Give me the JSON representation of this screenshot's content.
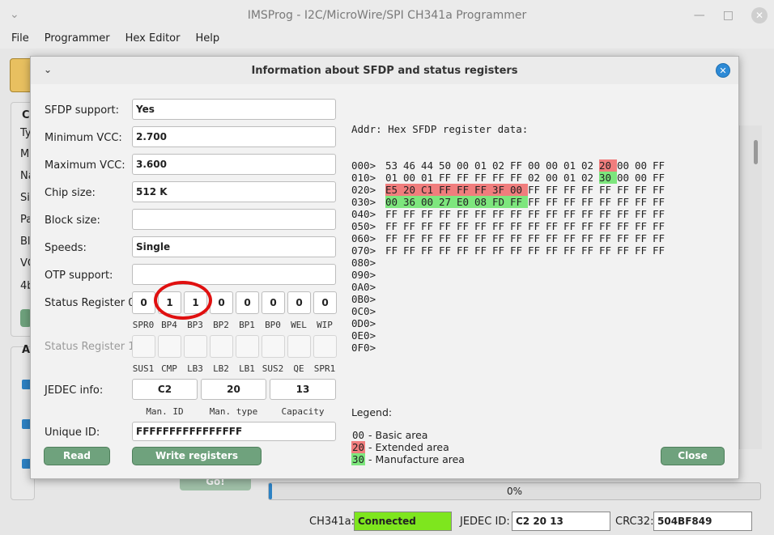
{
  "main": {
    "title": "IMSProg - I2C/MicroWire/SPI CH341a Programmer",
    "menu": [
      "File",
      "Programmer",
      "Hex Editor",
      "Help"
    ],
    "bg_labels": [
      "C",
      "Ty",
      "M",
      "Na",
      "Si",
      "Pa",
      "Bl",
      "VC",
      "4b",
      "A"
    ],
    "go_label": "Go!",
    "progress_text": "0%",
    "progress_value": 0.0,
    "status": {
      "ch341_label": "CH341a:",
      "ch341_value": "Connected",
      "jedec_label": "JEDEC ID:",
      "jedec_value": "C2 20 13",
      "crc_label": "CRC32:",
      "crc_value": "504BF849"
    }
  },
  "dialog": {
    "title": "Information about SFDP and status registers",
    "fields": [
      {
        "label": "SFDP support:",
        "value": "Yes"
      },
      {
        "label": "Minimum VCC:",
        "value": "2.700"
      },
      {
        "label": "Maximum VCC:",
        "value": "3.600"
      },
      {
        "label": "Chip size:",
        "value": "512 K"
      },
      {
        "label": "Block size:",
        "value": ""
      },
      {
        "label": "Speeds:",
        "value": "Single"
      },
      {
        "label": "OTP support:",
        "value": ""
      }
    ],
    "sr0": {
      "label": "Status Register 0",
      "bits": [
        "0",
        "1",
        "1",
        "0",
        "0",
        "0",
        "0",
        "0"
      ],
      "bit_names": [
        "SPR0",
        "BP4",
        "BP3",
        "BP2",
        "BP1",
        "BP0",
        "WEL",
        "WIP"
      ]
    },
    "sr1": {
      "label": "Status Register 1",
      "bits": [
        "",
        "",
        "",
        "",
        "",
        "",
        "",
        ""
      ],
      "bit_names": [
        "SUS1",
        "CMP",
        "LB3",
        "LB2",
        "LB1",
        "SUS2",
        "QE",
        "SPR1"
      ]
    },
    "jedec": {
      "label": "JEDEC info:",
      "values": [
        "C2",
        "20",
        "13"
      ],
      "names": [
        "Man. ID",
        "Man. type",
        "Capacity"
      ]
    },
    "unique": {
      "label": "Unique ID:",
      "value": "FFFFFFFFFFFFFFFF"
    },
    "buttons": {
      "read": "Read",
      "write": "Write registers",
      "close": "Close"
    },
    "hex_header": "Addr: Hex SFDP register data:",
    "hex_rows": [
      {
        "addr": "000>",
        "bytes": [
          "53",
          "46",
          "44",
          "50",
          "00",
          "01",
          "02",
          "FF",
          "00",
          "00",
          "01",
          "02",
          "20",
          "00",
          "00",
          "FF"
        ]
      },
      {
        "addr": "010>",
        "bytes": [
          "01",
          "00",
          "01",
          "FF",
          "FF",
          "FF",
          "FF",
          "FF",
          "02",
          "00",
          "01",
          "02",
          "30",
          "00",
          "00",
          "FF"
        ]
      },
      {
        "addr": "020>",
        "bytes": [
          "E5",
          "20",
          "C1",
          "FF",
          "FF",
          "FF",
          "3F",
          "00",
          "FF",
          "FF",
          "FF",
          "FF",
          "FF",
          "FF",
          "FF",
          "FF"
        ]
      },
      {
        "addr": "030>",
        "bytes": [
          "00",
          "36",
          "00",
          "27",
          "E0",
          "08",
          "FD",
          "FF",
          "FF",
          "FF",
          "FF",
          "FF",
          "FF",
          "FF",
          "FF",
          "FF"
        ]
      },
      {
        "addr": "040>",
        "bytes": [
          "FF",
          "FF",
          "FF",
          "FF",
          "FF",
          "FF",
          "FF",
          "FF",
          "FF",
          "FF",
          "FF",
          "FF",
          "FF",
          "FF",
          "FF",
          "FF"
        ]
      },
      {
        "addr": "050>",
        "bytes": [
          "FF",
          "FF",
          "FF",
          "FF",
          "FF",
          "FF",
          "FF",
          "FF",
          "FF",
          "FF",
          "FF",
          "FF",
          "FF",
          "FF",
          "FF",
          "FF"
        ]
      },
      {
        "addr": "060>",
        "bytes": [
          "FF",
          "FF",
          "FF",
          "FF",
          "FF",
          "FF",
          "FF",
          "FF",
          "FF",
          "FF",
          "FF",
          "FF",
          "FF",
          "FF",
          "FF",
          "FF"
        ]
      },
      {
        "addr": "070>",
        "bytes": [
          "FF",
          "FF",
          "FF",
          "FF",
          "FF",
          "FF",
          "FF",
          "FF",
          "FF",
          "FF",
          "FF",
          "FF",
          "FF",
          "FF",
          "FF",
          "FF"
        ]
      },
      {
        "addr": "080>",
        "bytes": []
      },
      {
        "addr": "090>",
        "bytes": []
      },
      {
        "addr": "0A0>",
        "bytes": []
      },
      {
        "addr": "0B0>",
        "bytes": []
      },
      {
        "addr": "0C0>",
        "bytes": []
      },
      {
        "addr": "0D0>",
        "bytes": []
      },
      {
        "addr": "0E0>",
        "bytes": []
      },
      {
        "addr": "0F0>",
        "bytes": []
      }
    ],
    "highlight": {
      "extended": [
        "0:12",
        "2:0",
        "2:1",
        "2:2",
        "2:3",
        "2:4",
        "2:5",
        "2:6",
        "2:7"
      ],
      "manufacture": [
        "1:12",
        "3:0",
        "3:1",
        "3:2",
        "3:3",
        "3:4",
        "3:5",
        "3:6",
        "3:7"
      ]
    },
    "legend": {
      "title": "Legend:",
      "items": [
        {
          "code": "00",
          "text": " - Basic area",
          "color": ""
        },
        {
          "code": "20",
          "text": " - Extended area",
          "color": "#f07d7d"
        },
        {
          "code": "30",
          "text": " - Manufacture area",
          "color": "#7de67d"
        }
      ]
    }
  },
  "colors": {
    "accent": "#2d8ad6",
    "button": "#6fa27d",
    "connected": "#7ee61e",
    "extended": "#f07d7d",
    "manufacture": "#7de67d"
  }
}
